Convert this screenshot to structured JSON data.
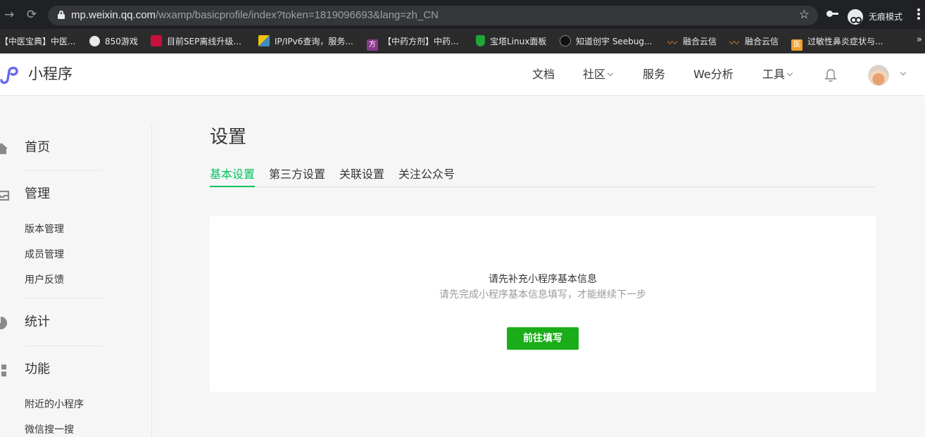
{
  "browser": {
    "url_host": "mp.weixin.qq.com",
    "url_path": "/wxamp/basicprofile/index?token=1819096693&lang=zh_CN",
    "incognito_label": "无痕模式"
  },
  "bookmarks": [
    {
      "label": "【中医宝典】中医...",
      "icon_color": ""
    },
    {
      "label": "850游戏",
      "icon_color": "#e8eaed"
    },
    {
      "label": "目前SEP离线升级...",
      "icon_color": "#c8103c"
    },
    {
      "label": "IP/IPv6查询，服务...",
      "icon_color": "#3c8dbc"
    },
    {
      "label": "【中药方剂】中药...",
      "icon_color": "#8b3a8b",
      "icon_text": "方"
    },
    {
      "label": "宝塔Linux面板",
      "icon_color": "#20a53a"
    },
    {
      "label": "知道创宇 Seebug...",
      "icon_color": "#111111"
    },
    {
      "label": "融合云信",
      "icon_color": "#f0821e"
    },
    {
      "label": "融合云信",
      "icon_color": "#f0821e"
    },
    {
      "label": "过敏性鼻炎症状与...",
      "icon_color": "#f0a030",
      "icon_text": "医"
    }
  ],
  "header": {
    "logo_text": "小程序",
    "nav": [
      {
        "label": "文档",
        "has_dropdown": false
      },
      {
        "label": "社区",
        "has_dropdown": true
      },
      {
        "label": "服务",
        "has_dropdown": false
      },
      {
        "label": "We分析",
        "has_dropdown": false
      },
      {
        "label": "工具",
        "has_dropdown": true
      }
    ]
  },
  "sidebar": {
    "groups": [
      {
        "label": "首页",
        "icon": "home-icon",
        "items": []
      },
      {
        "label": "管理",
        "icon": "inbox-icon",
        "items": [
          "版本管理",
          "成员管理",
          "用户反馈"
        ]
      },
      {
        "label": "统计",
        "icon": "pie-chart-icon",
        "items": []
      },
      {
        "label": "功能",
        "icon": "grid-icon",
        "items": [
          "附近的小程序",
          "微信搜一搜"
        ]
      }
    ]
  },
  "main": {
    "title": "设置",
    "tabs": [
      {
        "label": "基本设置",
        "active": true
      },
      {
        "label": "第三方设置",
        "active": false
      },
      {
        "label": "关联设置",
        "active": false
      },
      {
        "label": "关注公众号",
        "active": false
      }
    ],
    "notice_title": "请先补充小程序基本信息",
    "notice_sub": "请先完成小程序基本信息填写，才能继续下一步",
    "button_label": "前往填写"
  },
  "colors": {
    "accent_green": "#07c160",
    "button_green": "#1aad19",
    "logo_blue": "#6467f0"
  }
}
